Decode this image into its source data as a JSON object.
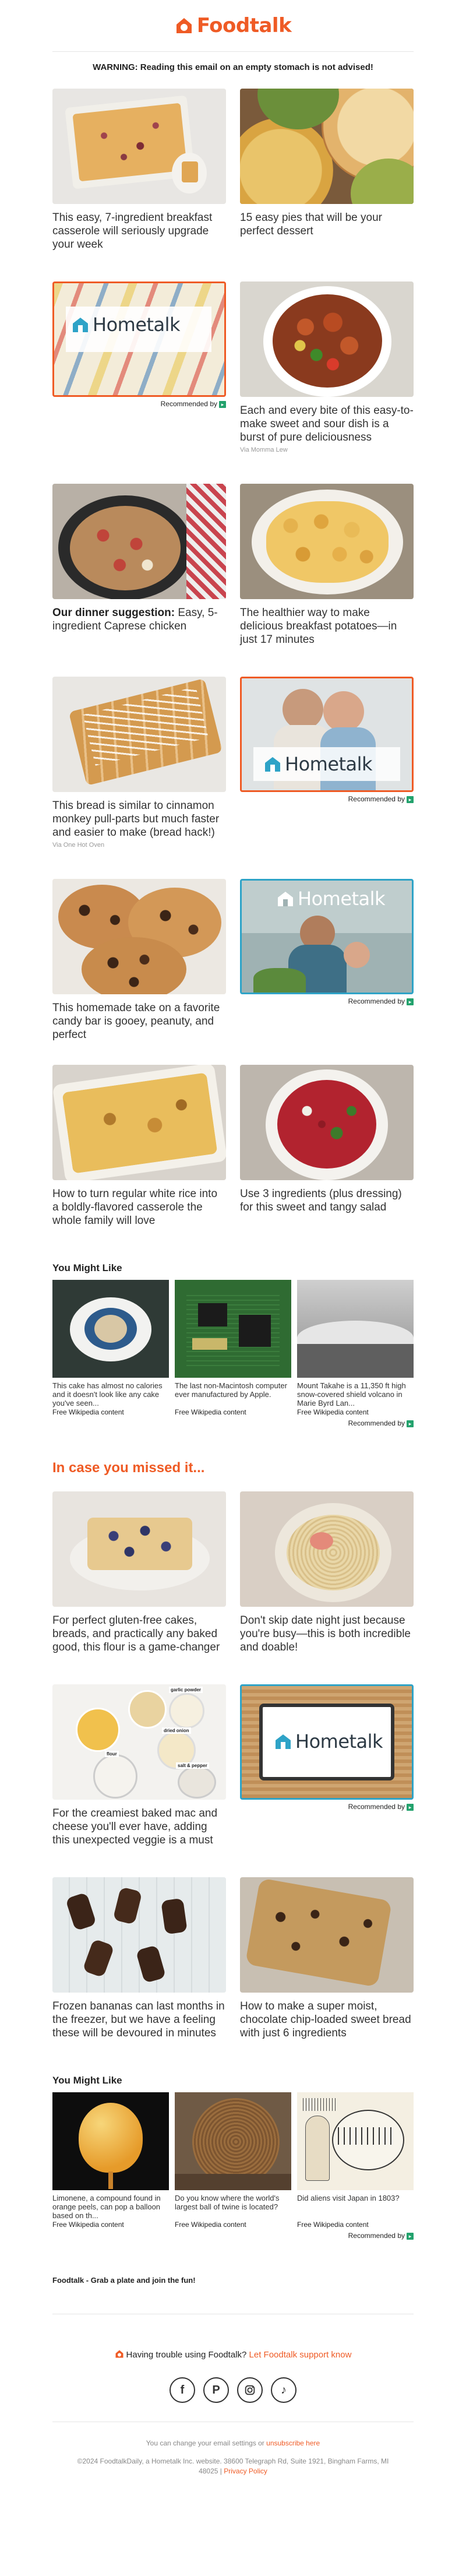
{
  "brand": {
    "name": "Foodtalk",
    "color": "#ef5b25"
  },
  "warning": "WARNING: Reading this email on an empty stomach is not advised!",
  "recommended_label": "Recommended by",
  "articles": [
    {
      "caption": "This easy, 7-ingredient breakfast casserole will seriously upgrade your week"
    },
    {
      "caption": "15 easy pies that will be your perfect dessert"
    },
    {
      "ad": "Hometalk"
    },
    {
      "caption": "Each and every bite of this easy-to-make sweet and sour dish is a burst of pure deliciousness",
      "via": "Via Momma Lew"
    },
    {
      "bold": "Our dinner suggestion:",
      "caption": " Easy, 5-ingredient Caprese chicken"
    },
    {
      "caption": "The healthier way to make delicious breakfast potatoes—in just 17 minutes"
    },
    {
      "caption": "This bread is similar to cinnamon monkey pull-parts but much faster and easier to make (bread hack!)",
      "via": "Via One Hot Oven"
    },
    {
      "ad": "Hometalk"
    },
    {
      "caption": "This homemade take on a favorite candy bar is gooey, peanuty, and perfect"
    },
    {
      "ad": "Hometalk"
    },
    {
      "caption": "How to turn regular white rice into a boldly-flavored casserole the whole family will love"
    },
    {
      "caption": "Use 3 ingredients (plus dressing) for this sweet and tangy salad"
    }
  ],
  "you_might_like_1": {
    "title": "You Might Like",
    "items": [
      {
        "text": "This cake has almost no calories and it doesn't look like any cake you've seen...",
        "source": "Free Wikipedia content"
      },
      {
        "text": "The last non-Macintosh computer ever manufactured by Apple.",
        "source": "Free Wikipedia content"
      },
      {
        "text": "Mount Takahe is a 11,350 ft high snow-covered shield volcano in Marie Byrd Lan...",
        "source": "Free Wikipedia content"
      }
    ]
  },
  "missed_title": "In case you missed it...",
  "missed": [
    {
      "caption": "For perfect gluten-free cakes, breads, and practically any baked good, this flour is a game-changer"
    },
    {
      "caption": "Don't skip date night just because you're busy—this is both incredible and doable!"
    },
    {
      "caption": "For the creamiest baked mac and cheese you'll ever have, adding this unexpected veggie is a must",
      "labels": [
        "garlic powder",
        "dried onion",
        "flour",
        "salt & pepper"
      ]
    },
    {
      "ad": "Hometalk"
    },
    {
      "caption": "Frozen bananas can last months in the freezer, but we have a feeling these will be devoured in minutes"
    },
    {
      "caption": "How to make a super moist, chocolate chip-loaded sweet bread with just 6 ingredients"
    }
  ],
  "you_might_like_2": {
    "title": "You Might Like",
    "items": [
      {
        "text": "Limonene, a compound found in orange peels, can pop a balloon based on th...",
        "source": "Free Wikipedia content"
      },
      {
        "text": "Do you know where the world's largest ball of twine is located?",
        "source": "Free Wikipedia content"
      },
      {
        "text": "Did aliens visit Japan in 1803?",
        "source": "Free Wikipedia content"
      }
    ]
  },
  "footer": {
    "tagline": "Foodtalk - Grab a plate and join the fun!",
    "trouble": "Having trouble using Foodtalk?",
    "support_link": "Let Foodtalk support know",
    "socials": [
      "facebook-icon",
      "pinterest-icon",
      "instagram-icon",
      "tiktok-icon"
    ],
    "settings_text": "You can change your email settings or",
    "unsubscribe": "unsubscribe here",
    "copyright": "©2024 FoodtalkDaily, a Hometalk Inc. website. 38600 Telegraph Rd, Suite 1921, Bingham Farms, MI 48025 |",
    "privacy": "Privacy Policy"
  }
}
